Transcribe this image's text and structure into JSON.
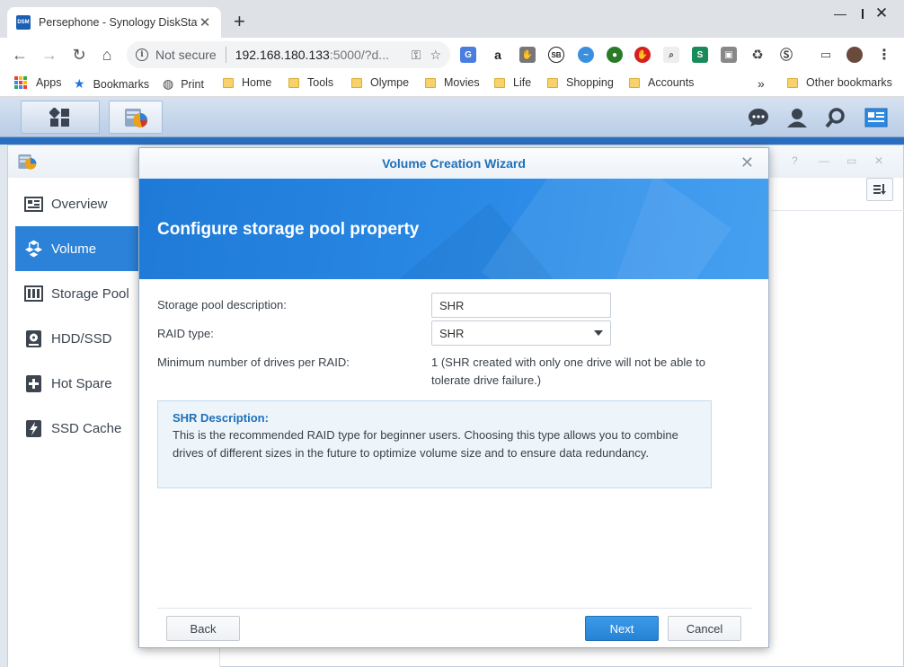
{
  "browser": {
    "tab_title": "Persephone - Synology DiskStatio",
    "tab_favicon_text": "DSM",
    "address_security": "Not secure",
    "url_host": "192.168.180.133",
    "url_rest": ":5000/?d...",
    "bookmarks": [
      {
        "label": "Apps"
      },
      {
        "label": "Bookmarks"
      },
      {
        "label": "Print"
      },
      {
        "label": "Home"
      },
      {
        "label": "Tools"
      },
      {
        "label": "Olympe"
      },
      {
        "label": "Movies"
      },
      {
        "label": "Life"
      },
      {
        "label": "Shopping"
      },
      {
        "label": "Accounts"
      }
    ],
    "other_bookmarks": "Other bookmarks",
    "overflow_chevron": "»"
  },
  "sidebar": {
    "items": [
      {
        "label": "Overview",
        "icon": "overview-icon"
      },
      {
        "label": "Volume",
        "icon": "volume-icon",
        "active": true
      },
      {
        "label": "Storage Pool",
        "icon": "storage-pool-icon"
      },
      {
        "label": "HDD/SSD",
        "icon": "hdd-icon"
      },
      {
        "label": "Hot Spare",
        "icon": "hot-spare-icon"
      },
      {
        "label": "SSD Cache",
        "icon": "ssd-cache-icon"
      }
    ]
  },
  "wizard": {
    "title": "Volume Creation Wizard",
    "heading": "Configure storage pool property",
    "fields": {
      "description_label": "Storage pool description:",
      "description_value": "SHR",
      "raid_label": "RAID type:",
      "raid_value": "SHR",
      "min_drives_label": "Minimum number of drives per RAID:",
      "min_drives_value": "1 (SHR created with only one drive will not be able to tolerate drive failure.)"
    },
    "description_box": {
      "title": "SHR Description:",
      "text": "This is the recommended RAID type for beginner users. Choosing this type allows you to combine drives of different sizes in the future to optimize volume size and to ensure data redundancy."
    },
    "buttons": {
      "back": "Back",
      "next": "Next",
      "cancel": "Cancel"
    }
  },
  "colors": {
    "accent": "#2c82d8",
    "banner": "#2a8ae6",
    "title_blue": "#1e70b8"
  }
}
